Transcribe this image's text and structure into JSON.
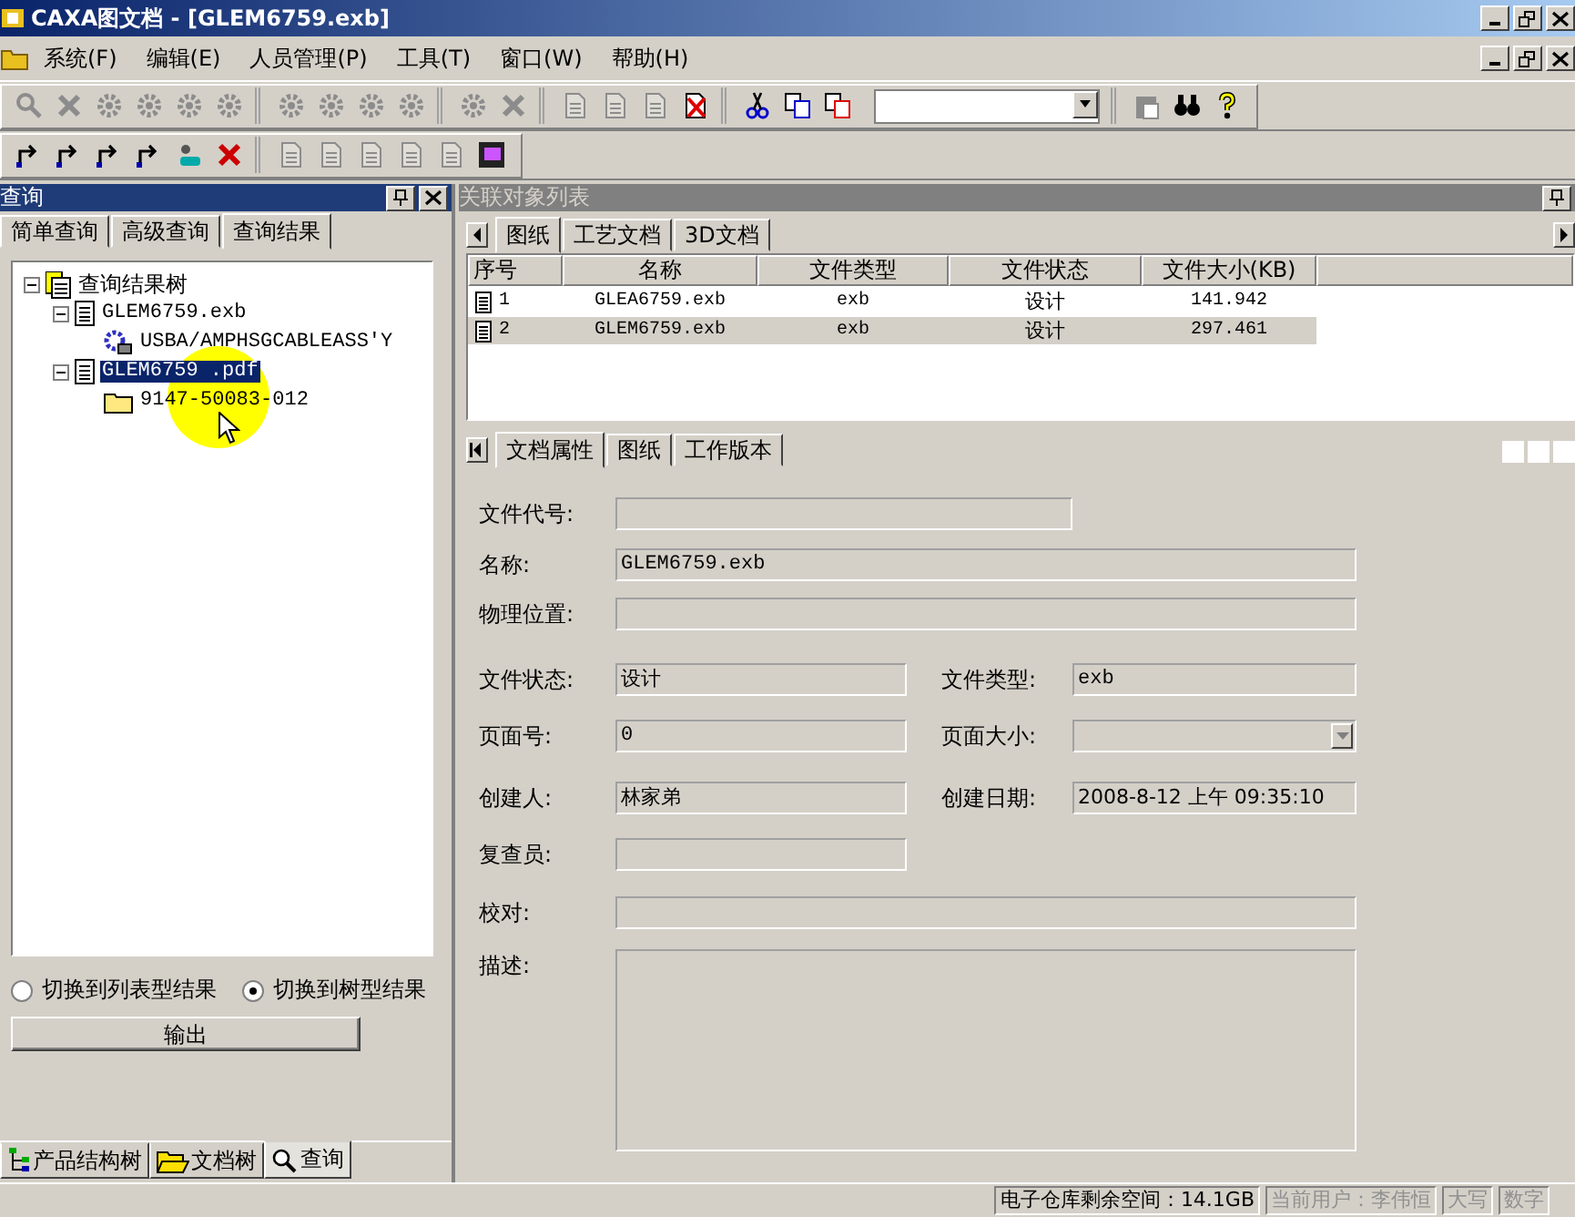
{
  "window": {
    "title": "CAXA图文档 - [GLEM6759.exb]"
  },
  "menu": [
    "系统(F)",
    "编辑(E)",
    "人员管理(P)",
    "工具(T)",
    "窗口(W)",
    "帮助(H)"
  ],
  "toolbars": [
    [
      {
        "kind": "icons",
        "items": [
          {
            "disabled": true
          },
          {
            "disabled": true
          },
          {
            "disabled": true
          },
          {
            "disabled": true
          },
          {
            "disabled": true
          },
          {
            "disabled": true
          }
        ]
      },
      {
        "kind": "icons",
        "items": [
          {
            "disabled": true
          },
          {
            "disabled": true
          },
          {
            "disabled": true
          },
          {
            "disabled": true
          }
        ]
      },
      {
        "kind": "icons",
        "items": [
          {
            "disabled": true
          },
          {
            "disabled": true
          }
        ]
      },
      {
        "kind": "icons",
        "items": [
          {
            "disabled": true
          },
          {
            "disabled": true
          },
          {
            "disabled": true
          },
          {
            "disabled": false
          }
        ]
      },
      {
        "kind": "icons",
        "items": [
          {
            "disabled": false
          },
          {
            "disabled": false
          },
          {
            "disabled": false
          }
        ]
      },
      {
        "kind": "combo"
      },
      {
        "kind": "icons",
        "items": [
          {
            "disabled": true
          },
          {
            "disabled": false
          },
          {
            "disabled": false
          }
        ]
      }
    ],
    [
      {
        "kind": "icons",
        "items": [
          {
            "disabled": false
          },
          {
            "disabled": false
          },
          {
            "disabled": false
          },
          {
            "disabled": false
          },
          {
            "disabled": false
          },
          {
            "disabled": false
          }
        ]
      },
      {
        "kind": "icons",
        "items": [
          {
            "disabled": true
          },
          {
            "disabled": true
          },
          {
            "disabled": true
          },
          {
            "disabled": true
          },
          {
            "disabled": true
          },
          {
            "disabled": false
          }
        ]
      }
    ]
  ],
  "query_panel": {
    "title": "查询",
    "tabs": [
      {
        "label": "简单查询",
        "selected": false
      },
      {
        "label": "高级查询",
        "selected": false
      },
      {
        "label": "查询结果",
        "selected": true
      }
    ],
    "tree": [
      {
        "label": "查询结果树",
        "kind": "root",
        "expanded": true,
        "selected": false,
        "children": [
          {
            "label": "GLEM6759.exb",
            "kind": "document",
            "expanded": true,
            "selected": false,
            "children": [
              {
                "label": "USBA/AMPHSGCABLEASS'Y",
                "kind": "part",
                "selected": false
              }
            ]
          },
          {
            "label": "GLEM6759 .pdf",
            "kind": "document",
            "expanded": true,
            "selected": true,
            "children": [
              {
                "label": "9147-50083-012",
                "kind": "folder",
                "selected": false
              }
            ]
          }
        ]
      }
    ],
    "view_options": [
      {
        "label": "切换到列表型结果",
        "selected": false
      },
      {
        "label": "切换到树型结果",
        "selected": true
      }
    ],
    "export_button": "输出",
    "bottom_tabs": [
      {
        "label": "产品结构树",
        "kind": "structure",
        "selected": false
      },
      {
        "label": "文档树",
        "kind": "folder",
        "selected": false
      },
      {
        "label": "查询",
        "kind": "search",
        "selected": true
      }
    ]
  },
  "related_panel": {
    "title": "关联对象列表",
    "tabs": [
      {
        "label": "图纸",
        "selected": true
      },
      {
        "label": "工艺文档",
        "selected": false
      },
      {
        "label": "3D文档",
        "selected": false
      }
    ],
    "table": {
      "columns": [
        "序号",
        "名称",
        "文件类型",
        "文件状态",
        "文件大小(KB)"
      ],
      "rows": [
        {
          "cells": [
            "1",
            "GLEA6759.exb",
            "exb",
            "设计",
            "141.942"
          ],
          "selected": false
        },
        {
          "cells": [
            "2",
            "GLEM6759.exb",
            "exb",
            "设计",
            "297.461"
          ],
          "selected": true
        }
      ]
    },
    "detail_tabs": [
      {
        "label": "文档属性",
        "selected": true
      },
      {
        "label": "图纸",
        "selected": false
      },
      {
        "label": "工作版本",
        "selected": false
      }
    ],
    "fields": [
      {
        "label": "文件代号:",
        "kind": "text"
      },
      {
        "label": "名称:",
        "kind": "text",
        "value": "GLEM6759.exb"
      },
      {
        "label": "物理位置:",
        "kind": "text"
      },
      {
        "label": "文件状态:",
        "kind": "text",
        "value": "设计"
      },
      {
        "label": "文件类型:",
        "kind": "text",
        "value": "exb"
      },
      {
        "label": "页面号:",
        "kind": "text",
        "value": "0"
      },
      {
        "label": "页面大小:",
        "kind": "dropdown"
      },
      {
        "label": "创建人:",
        "kind": "text",
        "value": "林家弟"
      },
      {
        "label": "创建日期:",
        "kind": "text",
        "value": "2008-8-12 上午 09:35:10"
      },
      {
        "label": "复查员:",
        "kind": "text"
      },
      {
        "label": "校对:",
        "kind": "text"
      },
      {
        "label": "描述:",
        "kind": "textarea"
      }
    ]
  },
  "status_bar": [
    {
      "text": "电子仓库剩余空间：14.1GB",
      "disabled": false
    },
    {
      "text": "当前用户：李伟恒",
      "disabled": true
    },
    {
      "text": "大写",
      "disabled": true
    },
    {
      "text": "数字",
      "disabled": true
    }
  ]
}
